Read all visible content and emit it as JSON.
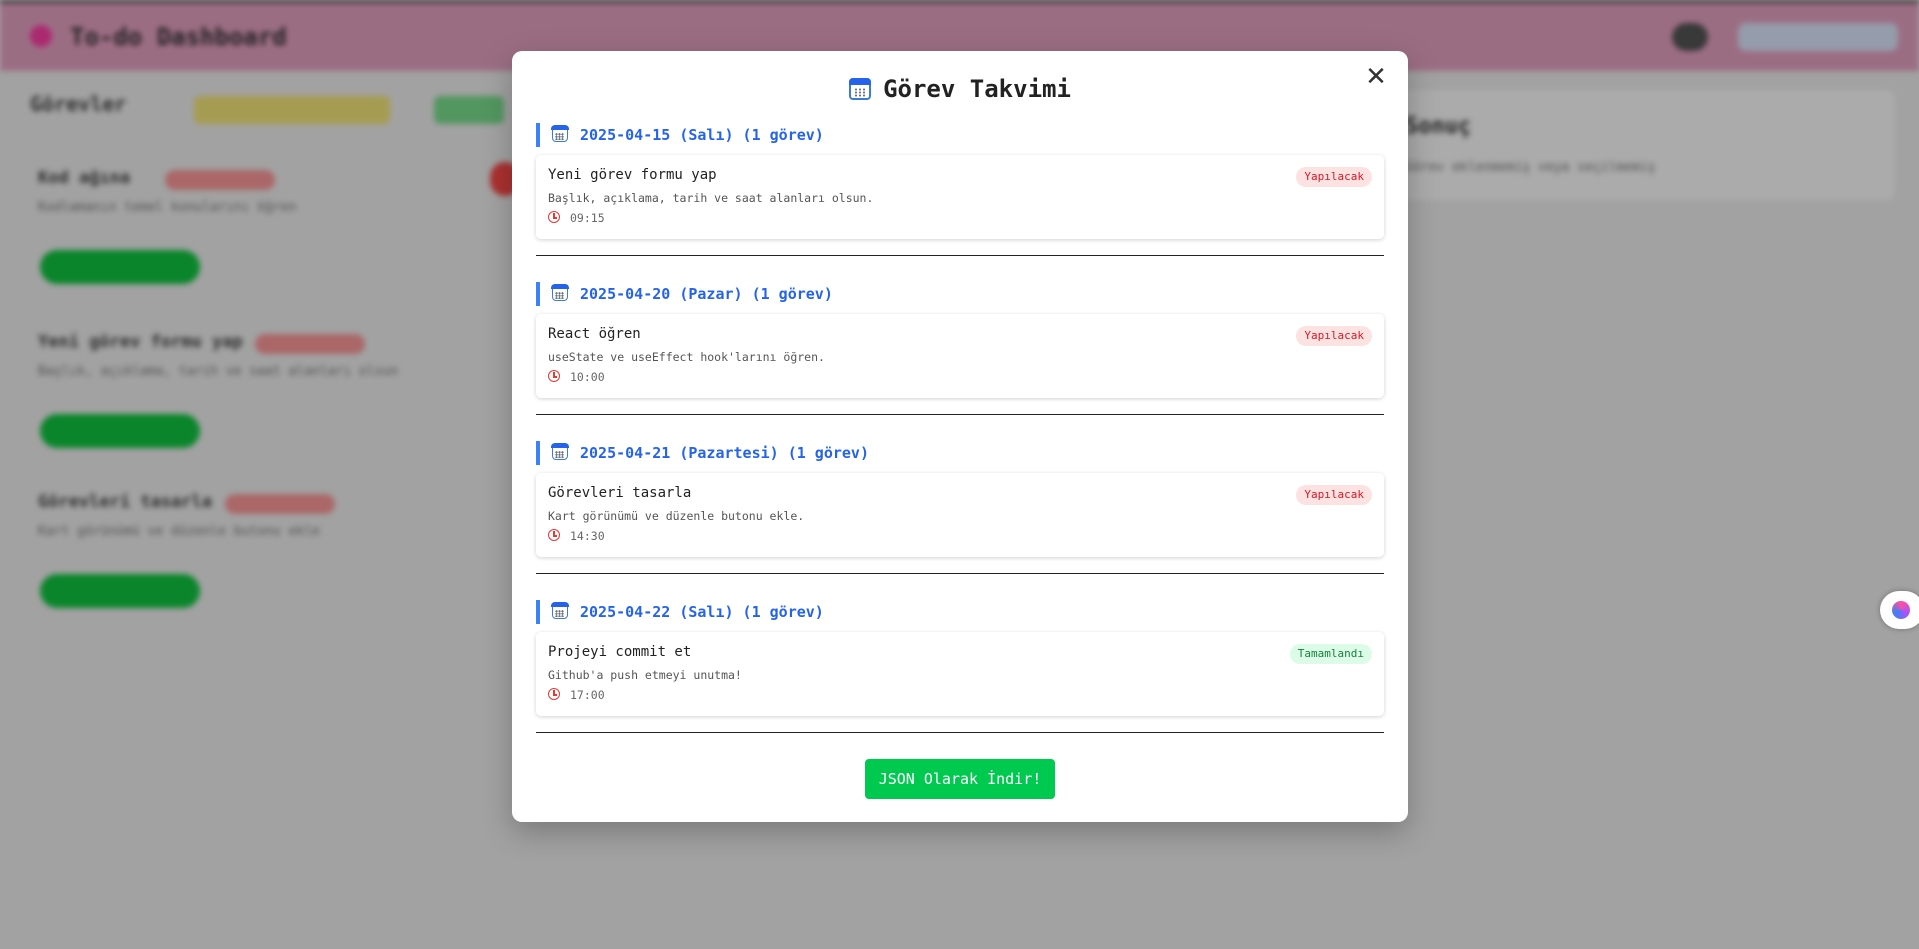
{
  "background": {
    "brand_title": "To-do Dashboard",
    "section_heading": "Görevler",
    "right_panel_heading": "Sonuç",
    "right_panel_sub": "Görev eklenmemiş veya seçilmemiş",
    "cards": [
      {
        "title": "Kod ağına",
        "desc": "Kodlamanın temel konularını öğren"
      },
      {
        "title": "Yeni görev formu yap",
        "desc": "Başlık, açıklama, tarih ve saat alanları olsun"
      },
      {
        "title": "Görevleri tasarla",
        "desc": "Kart görünümü ve düzenle butonu ekle"
      }
    ]
  },
  "modal": {
    "title": "Görev Takvimi",
    "close_label": "✕",
    "groups": [
      {
        "header": "2025-04-15 (Salı) (1 görev)",
        "task": {
          "title": "Yeni görev formu yap",
          "desc": "Başlık, açıklama, tarih ve saat alanları olsun.",
          "time": "09:15",
          "status": "Yapılacak",
          "status_kind": "todo"
        }
      },
      {
        "header": "2025-04-20 (Pazar) (1 görev)",
        "task": {
          "title": "React öğren",
          "desc": "useState ve useEffect hook'larını öğren.",
          "time": "10:00",
          "status": "Yapılacak",
          "status_kind": "todo"
        }
      },
      {
        "header": "2025-04-21 (Pazartesi) (1 görev)",
        "task": {
          "title": "Görevleri tasarla",
          "desc": "Kart görünümü ve düzenle butonu ekle.",
          "time": "14:30",
          "status": "Yapılacak",
          "status_kind": "todo"
        }
      },
      {
        "header": "2025-04-22 (Salı) (1 görev)",
        "task": {
          "title": "Projeyi commit et",
          "desc": "Github'a push etmeyi unutma!",
          "time": "17:00",
          "status": "Tamamlandı",
          "status_kind": "done"
        }
      }
    ],
    "download_button": "JSON Olarak İndir!"
  },
  "colors": {
    "accent_blue": "#2563eb",
    "download_green": "#00c950",
    "todo_red": "#d11a2a",
    "done_green": "#15803d"
  }
}
